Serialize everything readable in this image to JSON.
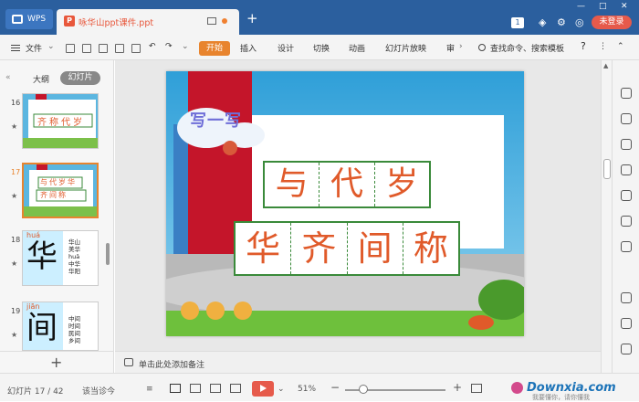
{
  "titlebar": {
    "app_label": "WPS",
    "doc_tab_title": "咏华山ppt课件.ppt",
    "badge": "1",
    "login_label": "未登录"
  },
  "toolbar": {
    "file_label": "文件",
    "tabs": [
      "开始",
      "插入",
      "设计",
      "切换",
      "动画",
      "幻灯片放映",
      "审"
    ],
    "search_label": "查找命令、搜索模板",
    "help": "?"
  },
  "left_panel": {
    "outline_tab": "大纲",
    "slides_tab": "幻灯片",
    "thumbnails": [
      {
        "num": "16",
        "chars": "齐称代岁",
        "selected": false
      },
      {
        "num": "17",
        "chars": "与代岁华齐间称",
        "selected": true
      },
      {
        "num": "18",
        "big_char": "华",
        "pinyin": "huá",
        "words": [
          "华山",
          "美华",
          "huā",
          "中华",
          "华阳"
        ],
        "selected": false
      },
      {
        "num": "19",
        "big_char": "间",
        "pinyin": "jiān",
        "words": [
          "中间",
          "时间",
          "民间",
          "乡间"
        ],
        "selected": false
      }
    ]
  },
  "slide": {
    "heading": "写一写",
    "row1": [
      "与",
      "代",
      "岁"
    ],
    "row2": [
      "华",
      "齐",
      "间",
      "称"
    ]
  },
  "notes_placeholder": "单击此处添加备注",
  "statusbar": {
    "slide_counter": "幻灯片 17 / 42",
    "proofing": "该当诊今",
    "zoom": "51%",
    "zoom_fraction": 0.18
  },
  "watermark": {
    "brand": "Downxia.com",
    "sub": "我要懂你，请你懂我"
  },
  "colors": {
    "titlebar": "#2b5f9e",
    "accent": "#e8842e",
    "login": "#e65a4b",
    "slide_red": "#c4152a",
    "char_red": "#e05a2a",
    "grid_green": "#3a8a3a"
  }
}
